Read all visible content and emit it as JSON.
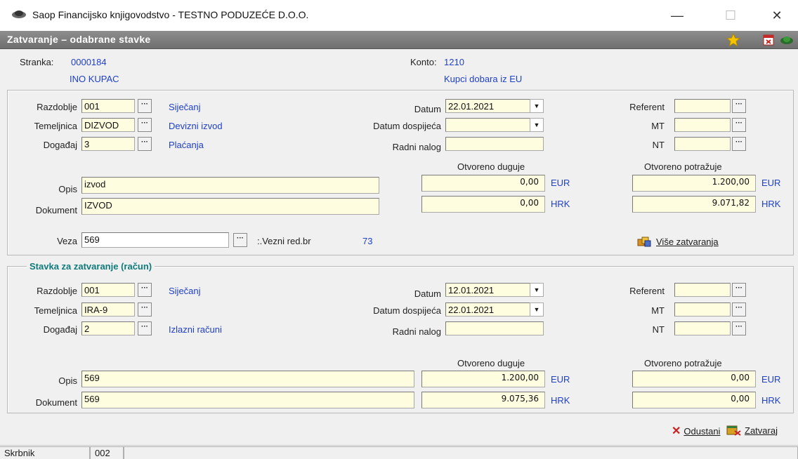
{
  "window": {
    "title": "Saop Financijsko knjigovodstvo - TESTNO PODUZEĆE D.O.O.",
    "min": "—",
    "max": "☐",
    "close": "✕"
  },
  "header": {
    "title": "Zatvaranje – odabrane stavke"
  },
  "top": {
    "stranka_label": "Stranka:",
    "stranka_value": "0000184",
    "stranka_name": "INO KUPAC",
    "konto_label": "Konto:",
    "konto_value": "1210",
    "konto_name": "Kupci dobara iz EU"
  },
  "labels": {
    "razdoblje": "Razdoblje",
    "temeljnica": "Temeljnica",
    "dogadaj": "Događaj",
    "datum": "Datum",
    "datum_dosp": "Datum dospijeća",
    "radni_nalog": "Radni nalog",
    "referent": "Referent",
    "mt": "MT",
    "nt": "NT",
    "otv_duguje": "Otvoreno duguje",
    "otv_potrazuje": "Otvoreno potražuje",
    "opis": "Opis",
    "dokument": "Dokument",
    "veza": "Veza",
    "vezni": ":.Vezni red.br",
    "dots": "···",
    "dd": "▼"
  },
  "section1": {
    "razdoblje": "001",
    "razdoblje_name": "Siječanj",
    "temeljnica": "DIZVOD",
    "temeljnica_name": "Devizni izvod",
    "dogadaj": "3",
    "dogadaj_name": "Plaćanja",
    "datum": "22.01.2021",
    "datum_dosp": "",
    "radni_nalog": "",
    "referent": "",
    "mt": "",
    "nt": "",
    "opis": "izvod",
    "dokument": "IZVOD",
    "duguje_eur": "0,00",
    "duguje_hrk": "0,00",
    "potrazuje_eur": "1.200,00",
    "potrazuje_hrk": "9.071,82",
    "cur1": "EUR",
    "cur2": "HRK",
    "veza": "569",
    "vezni_value": "73",
    "vise_button": "Više zatvaranja"
  },
  "section2": {
    "title": "Stavka za zatvaranje (račun)",
    "razdoblje": "001",
    "razdoblje_name": "Siječanj",
    "temeljnica": "IRA-9",
    "dogadaj": "2",
    "dogadaj_name": "Izlazni računi",
    "datum": "12.01.2021",
    "datum_dosp": "22.01.2021",
    "radni_nalog": "",
    "referent": "",
    "mt": "",
    "nt": "",
    "opis": "569",
    "dokument": "569",
    "duguje_eur": "1.200,00",
    "duguje_hrk": "9.075,36",
    "potrazuje_eur": "0,00",
    "potrazuje_hrk": "0,00",
    "cur1": "EUR",
    "cur2": "HRK"
  },
  "buttons": {
    "odustani": "Odustani",
    "zatvaraj": "Zatvaraj"
  },
  "status": {
    "label": "Skrbnik",
    "value": "002"
  }
}
